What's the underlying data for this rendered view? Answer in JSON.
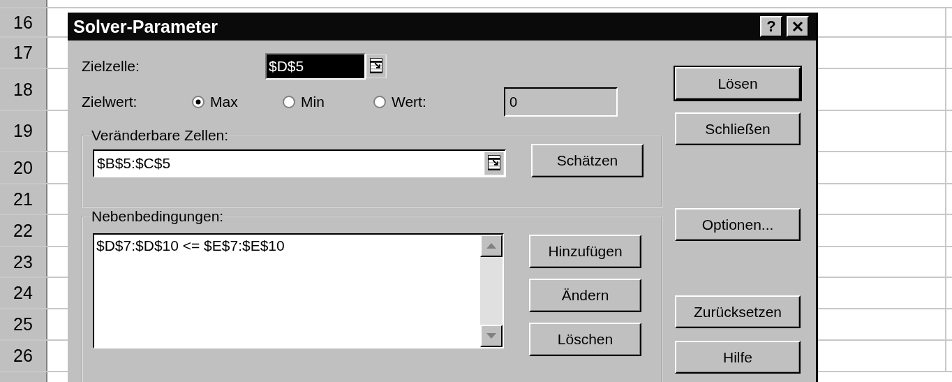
{
  "row_headers": [
    "16",
    "17",
    "18",
    "19",
    "20",
    "21",
    "22",
    "23",
    "24",
    "25",
    "26"
  ],
  "dialog": {
    "title": "Solver-Parameter",
    "help_button": "?",
    "target_cell": {
      "label": "Zielzelle:",
      "value": "$D$5",
      "selected": true
    },
    "target_value": {
      "label": "Zielwert:",
      "options": [
        {
          "label": "Max",
          "selected": true
        },
        {
          "label": "Min",
          "selected": false
        },
        {
          "label": "Wert:",
          "selected": false
        }
      ],
      "value_field": {
        "value": "0",
        "disabled": true
      }
    },
    "changing_cells": {
      "title": "Veränderbare Zellen:",
      "value": "$B$5:$C$5",
      "button": "Schätzen"
    },
    "constraints": {
      "title": "Nebenbedingungen:",
      "items": [
        "$D$7:$D$10 <= $E$7:$E$10"
      ],
      "buttons": [
        "Hinzufügen",
        "Ändern",
        "Löschen"
      ]
    },
    "side_buttons": [
      {
        "label": "Lösen",
        "default": true,
        "kind": "top"
      },
      {
        "label": "Schließen",
        "default": false,
        "kind": "top"
      },
      {
        "label": "Optionen...",
        "default": false,
        "kind": "middle"
      },
      {
        "label": "Zurücksetzen",
        "default": false,
        "kind": "bottom"
      },
      {
        "label": "Hilfe",
        "default": false,
        "kind": "bottom"
      }
    ]
  }
}
